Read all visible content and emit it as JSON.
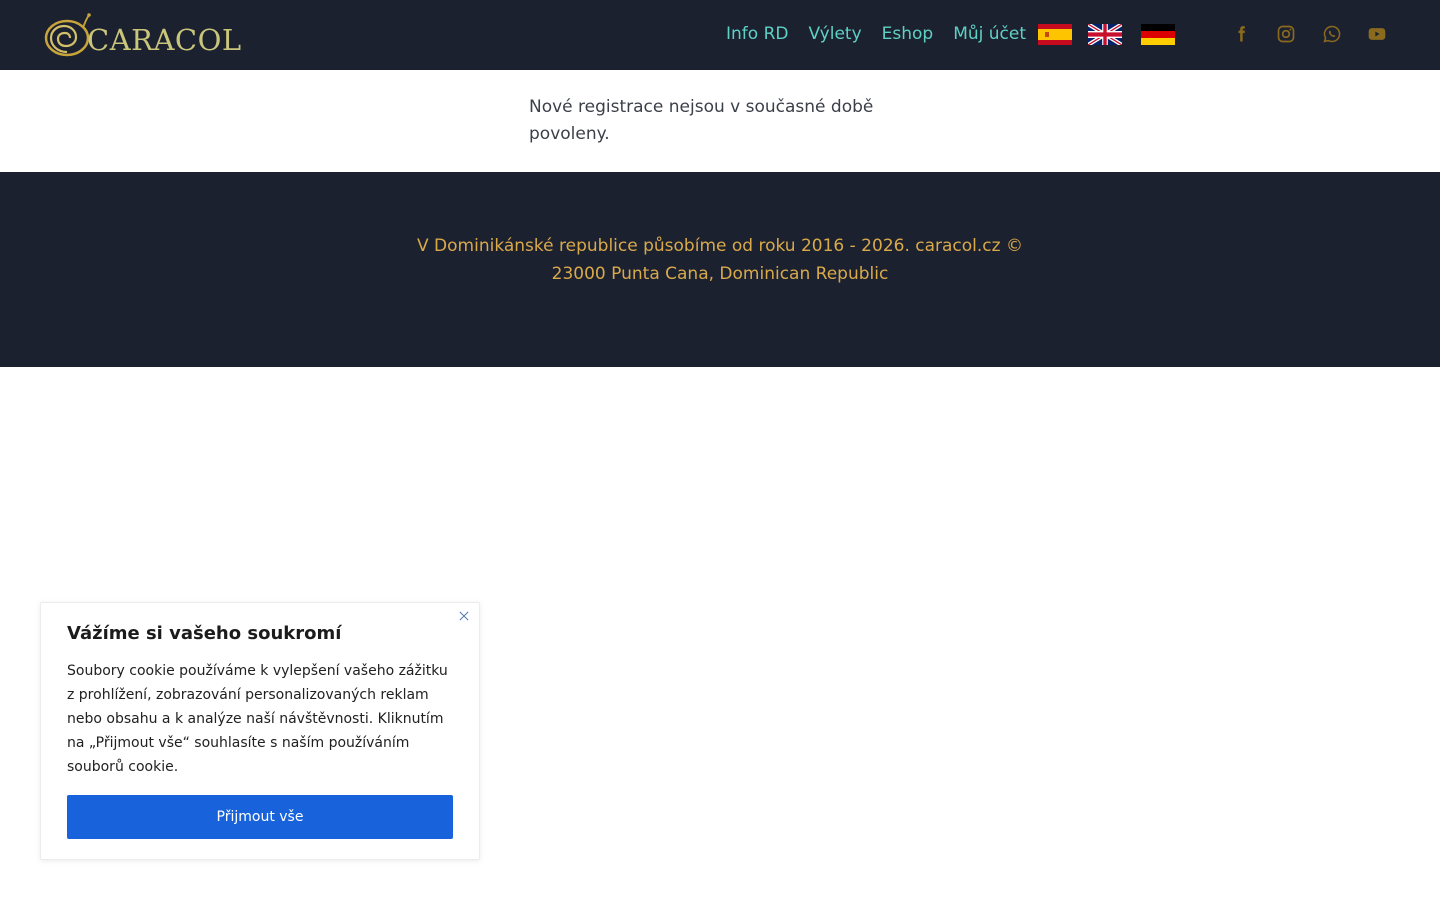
{
  "header": {
    "logo_text": "CARACOL",
    "logo_color": "#c9c57a",
    "nav": [
      {
        "label": "Info RD"
      },
      {
        "label": "Výlety"
      },
      {
        "label": "Eshop"
      },
      {
        "label": "Můj účet"
      }
    ],
    "nav_color": "#5fd1c4",
    "languages": [
      "es-flag-icon",
      "gb-flag-icon",
      "de-flag-icon"
    ],
    "social_icons": [
      "facebook-icon",
      "instagram-icon",
      "whatsapp-icon",
      "youtube-icon"
    ],
    "social_color": "#8a6a1e"
  },
  "main": {
    "message": "Nové registrace nejsou v současné době povoleny."
  },
  "footer": {
    "line1": "V Dominikánské republice působíme od roku 2016 - 2026. caracol.cz ©",
    "line2": "23000 Punta Cana, Dominican Republic",
    "text_color": "#d9a94a"
  },
  "cookie": {
    "title": "Vážíme si vašeho soukromí",
    "body": "Soubory cookie používáme k vylepšení vašeho zážitku z prohlížení, zobrazování personalizovaných reklam nebo obsahu a k analýze naší návštěvnosti. Kliknutím na „Přijmout vše“ souhlasíte s naším používáním souborů cookie.",
    "accept_label": "Přijmout vše",
    "accept_color": "#1863dc"
  },
  "colors": {
    "header_bg": "#1c2130",
    "footer_bg": "#1c2130"
  }
}
